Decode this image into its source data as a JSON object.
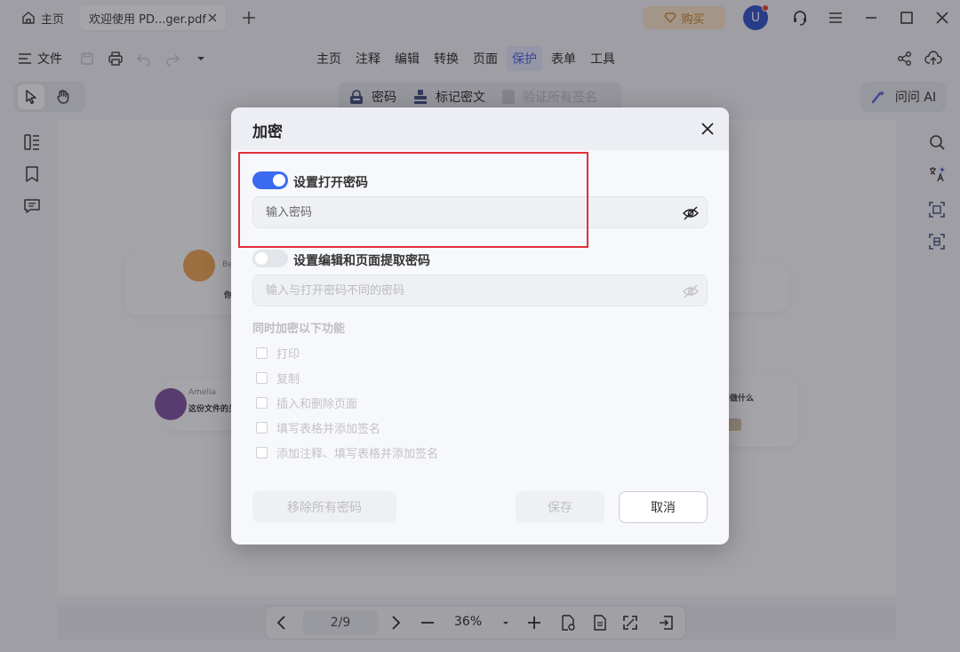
{
  "titlebar": {
    "home_tab": "主页",
    "doc_tab": "欢迎使用 PD...ger.pdf",
    "buy_label": "购买",
    "avatar_letter": "U"
  },
  "menubar": {
    "file_label": "文件",
    "items": [
      "主页",
      "注释",
      "编辑",
      "转换",
      "页面",
      "保护",
      "表单",
      "工具"
    ],
    "active_item": "保护"
  },
  "toolbar": {
    "encrypt_label": "密码",
    "redact_label": "标记密文",
    "verify_label": "验证所有签名",
    "ai_label": "问问 AI"
  },
  "document": {
    "blob1_name": "Be...",
    "blob1_text": "你...",
    "blob2_name": "Amelia",
    "blob2_text": "这份文件的关...",
    "blob3_text": "要做什么"
  },
  "pagenav": {
    "page": "2/9",
    "zoom": "36%"
  },
  "dialog": {
    "title": "加密",
    "open_password_toggle": "设置打开密码",
    "open_password_on": true,
    "open_password_placeholder": "输入密码",
    "edit_password_toggle": "设置编辑和页面提取密码",
    "edit_password_on": false,
    "edit_password_placeholder": "输入与打开密码不同的密码",
    "section_title": "同时加密以下功能",
    "options": [
      "打印",
      "复制",
      "插入和删除页面",
      "填写表格并添加签名",
      "添加注释、填写表格并添加签名"
    ],
    "remove_all_label": "移除所有密码",
    "save_label": "保存",
    "cancel_label": "取消"
  },
  "colors": {
    "accent": "#3a6af0",
    "highlight": "#e0303a",
    "protect_tab": "#4a5bdc"
  }
}
